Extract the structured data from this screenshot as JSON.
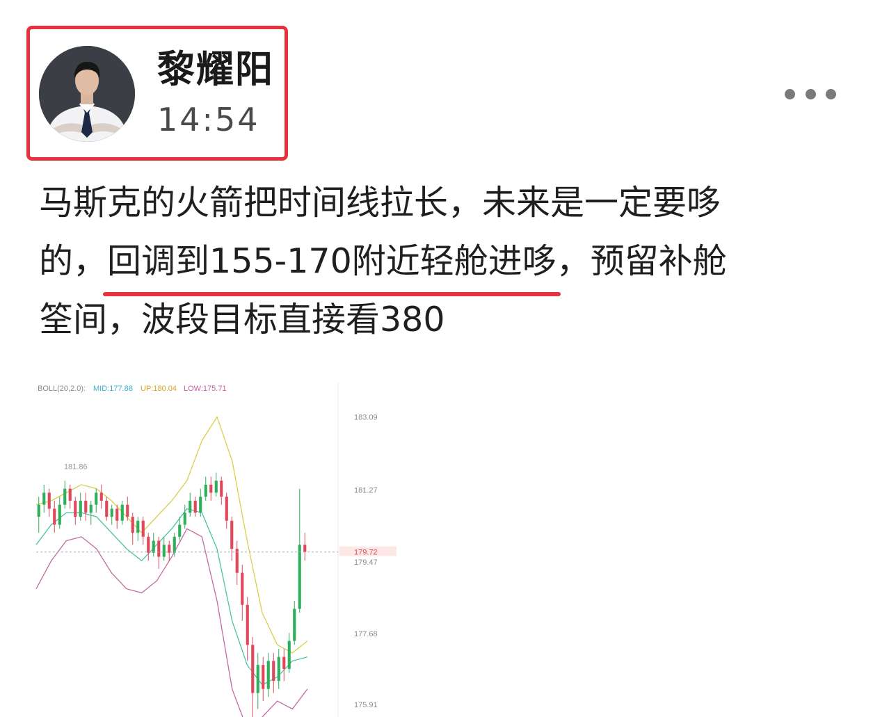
{
  "author": {
    "name": "黎耀阳",
    "time": "14:54"
  },
  "post": {
    "line1": "马斯克的火箭把时间线拉长，未来是一定要哆",
    "line2_prefix": "的，",
    "line2_highlight": "回调到155-170附近轻舱进哆",
    "line2_suffix": "，预留补舱",
    "line3": "筌间，波段目标直接看380"
  },
  "chart_data": {
    "type": "line",
    "indicator": {
      "prefix": "BOLL(20,2.0):",
      "mid": "MID:177.88",
      "up": "UP:180.04",
      "low": "LOW:175.71"
    },
    "high_marker": "181.86",
    "y_ticks": [
      "183.09",
      "181.27",
      "179.47",
      "177.68",
      "175.91"
    ],
    "current_price": "179.72",
    "ylim": [
      175.6,
      183.5
    ],
    "up_color": "#2fae5b",
    "down_color": "#e0475a",
    "up_band": [
      180.9,
      181.0,
      181.2,
      181.4,
      181.3,
      181.0,
      180.6,
      180.2,
      180.6,
      181.0,
      181.5,
      182.5,
      183.09,
      182.0,
      180.0,
      178.2,
      177.4,
      177.2,
      177.5
    ],
    "mid_band": [
      179.9,
      180.4,
      180.7,
      180.7,
      180.6,
      180.2,
      179.8,
      179.5,
      179.9,
      180.3,
      180.8,
      180.7,
      179.8,
      178.0,
      176.9,
      176.4,
      176.6,
      177.0,
      177.1
    ],
    "low_band": [
      178.8,
      179.5,
      180.0,
      180.1,
      179.8,
      179.2,
      178.8,
      178.7,
      179.0,
      179.6,
      180.3,
      180.1,
      178.5,
      176.3,
      175.3,
      175.6,
      176.0,
      175.8,
      176.3
    ],
    "candles": [
      [
        180.6,
        180.9,
        180.2,
        181.1
      ],
      [
        180.9,
        181.2,
        180.7,
        181.4
      ],
      [
        181.2,
        180.8,
        180.6,
        181.3
      ],
      [
        180.8,
        180.4,
        180.2,
        181.0
      ],
      [
        180.4,
        180.9,
        180.3,
        181.1
      ],
      [
        180.9,
        181.3,
        180.8,
        181.5
      ],
      [
        181.3,
        181.0,
        180.8,
        181.4
      ],
      [
        181.0,
        180.6,
        180.4,
        181.1
      ],
      [
        180.6,
        181.0,
        180.5,
        181.2
      ],
      [
        181.0,
        180.7,
        180.5,
        181.2
      ],
      [
        180.7,
        180.9,
        180.4,
        181.0
      ],
      [
        180.9,
        181.2,
        180.7,
        181.3
      ],
      [
        181.2,
        181.0,
        180.8,
        181.4
      ],
      [
        181.0,
        180.6,
        180.5,
        181.1
      ],
      [
        180.6,
        180.8,
        180.4,
        180.9
      ],
      [
        180.8,
        180.5,
        180.3,
        180.9
      ],
      [
        180.5,
        180.9,
        180.4,
        181.0
      ],
      [
        180.9,
        180.6,
        180.5,
        181.1
      ],
      [
        180.6,
        180.2,
        179.9,
        180.7
      ],
      [
        180.2,
        180.5,
        180.0,
        180.6
      ],
      [
        180.5,
        180.1,
        179.9,
        180.6
      ],
      [
        180.1,
        179.7,
        179.5,
        180.2
      ],
      [
        179.7,
        180.0,
        179.6,
        180.2
      ],
      [
        180.0,
        179.6,
        179.3,
        180.1
      ],
      [
        179.6,
        179.9,
        179.5,
        180.1
      ],
      [
        179.9,
        179.7,
        179.5,
        180.0
      ],
      [
        179.7,
        180.1,
        179.6,
        180.2
      ],
      [
        180.1,
        180.4,
        180.0,
        180.6
      ],
      [
        180.4,
        180.7,
        180.3,
        180.9
      ],
      [
        180.7,
        181.0,
        180.6,
        181.2
      ],
      [
        181.0,
        180.7,
        180.6,
        181.1
      ],
      [
        180.7,
        181.1,
        180.6,
        181.3
      ],
      [
        181.1,
        181.4,
        181.0,
        181.6
      ],
      [
        181.4,
        181.2,
        181.0,
        181.6
      ],
      [
        181.2,
        181.5,
        181.1,
        181.7
      ],
      [
        181.5,
        181.1,
        180.9,
        181.6
      ],
      [
        181.1,
        180.5,
        180.3,
        181.2
      ],
      [
        180.5,
        179.8,
        179.5,
        180.6
      ],
      [
        179.8,
        179.2,
        178.9,
        180.0
      ],
      [
        179.2,
        178.4,
        178.0,
        179.4
      ],
      [
        178.4,
        177.4,
        177.0,
        178.6
      ],
      [
        177.4,
        176.2,
        175.6,
        177.6
      ],
      [
        176.2,
        176.9,
        175.8,
        177.2
      ],
      [
        176.9,
        176.3,
        176.0,
        177.1
      ],
      [
        176.3,
        177.0,
        176.1,
        177.2
      ],
      [
        177.0,
        176.5,
        176.2,
        177.2
      ],
      [
        176.5,
        177.1,
        176.3,
        177.3
      ],
      [
        177.1,
        176.8,
        176.5,
        177.3
      ],
      [
        176.8,
        177.5,
        176.7,
        177.7
      ],
      [
        177.5,
        178.3,
        177.4,
        178.5
      ],
      [
        178.3,
        179.9,
        178.2,
        181.3
      ],
      [
        179.9,
        179.72,
        179.5,
        180.2
      ]
    ]
  }
}
